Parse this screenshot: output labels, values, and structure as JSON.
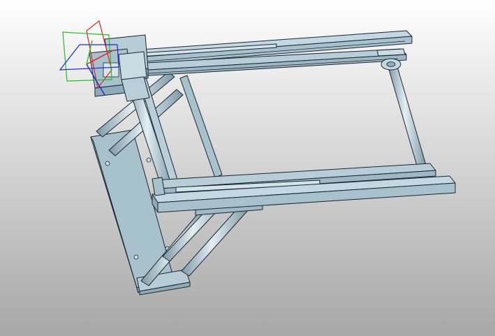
{
  "viewport": {
    "background_top": "#ffffff",
    "background_bottom": "#a7a7a7"
  },
  "model": {
    "body_color": "#a7c1cd",
    "face_color": "#b9d1dc",
    "shadow_color": "#8fabb8",
    "rail_color": "#c3d8e2",
    "edge_color": "#1b2630"
  },
  "triad": {
    "x_plane_color": "#e02020",
    "y_plane_color": "#20c020",
    "z_axis_color": "#1a2ad8"
  }
}
